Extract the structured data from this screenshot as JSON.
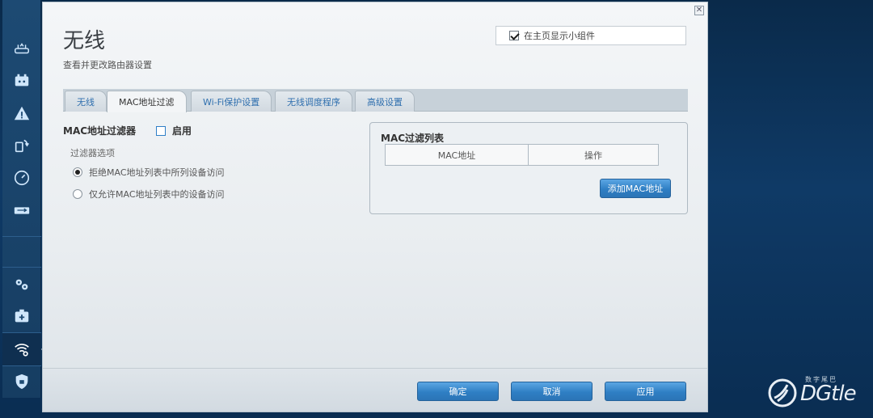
{
  "window": {
    "title": "无线",
    "subtitle": "查看并更改路由器设置",
    "show_widget_label": "在主页显示小组件",
    "show_widget_checked": true
  },
  "tabs": [
    {
      "label": "无线",
      "active": false
    },
    {
      "label": "MAC地址过滤",
      "active": true
    },
    {
      "label": "Wi-Fi保护设置",
      "active": false
    },
    {
      "label": "无线调度程序",
      "active": false
    },
    {
      "label": "高级设置",
      "active": false
    }
  ],
  "mac_filter": {
    "label": "MAC地址过滤器",
    "enable_label": "启用",
    "enabled": false,
    "options_label": "过滤器选项",
    "options": [
      {
        "label": "拒绝MAC地址列表中所列设备访问",
        "selected": true
      },
      {
        "label": "仅允许MAC地址列表中的设备访问",
        "selected": false
      }
    ]
  },
  "mac_list": {
    "title": "MAC过滤列表",
    "columns": [
      "MAC地址",
      "操作"
    ],
    "add_button": "添加MAC地址"
  },
  "footer": {
    "ok": "确定",
    "cancel": "取消",
    "apply": "应用"
  },
  "sidebar": {
    "items": [
      {
        "icon": "router-icon"
      },
      {
        "icon": "devices-icon"
      },
      {
        "icon": "alert-icon"
      },
      {
        "icon": "media-icon"
      },
      {
        "icon": "speed-icon"
      },
      {
        "icon": "usb-storage-icon"
      },
      {
        "icon": "settings-icon"
      },
      {
        "icon": "diagnostics-icon"
      },
      {
        "icon": "wifi-settings-icon",
        "active": true
      },
      {
        "icon": "security-icon"
      }
    ]
  },
  "watermark": {
    "text": "DGtle",
    "subtext": "数字尾巴"
  },
  "colors": {
    "accent": "#2f7fc4",
    "tab_text": "#2f6fae",
    "background": "#0f3a66"
  }
}
